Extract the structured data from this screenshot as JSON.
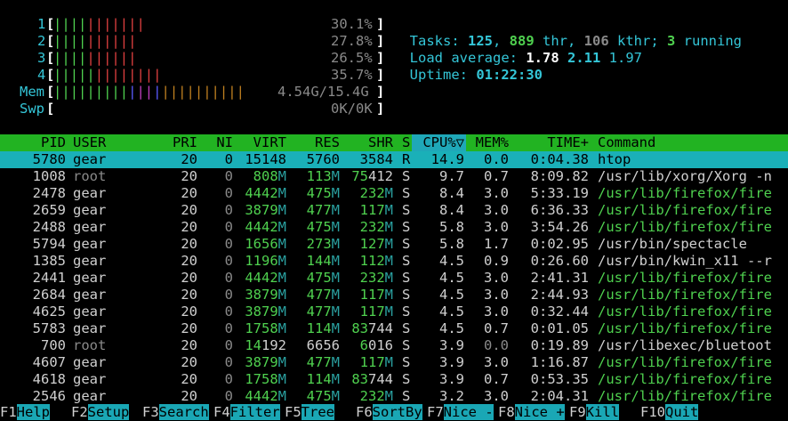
{
  "meters": {
    "cpus": [
      {
        "label": "1",
        "percent_text": "30.1%",
        "level": 30.1
      },
      {
        "label": "2",
        "percent_text": "27.8%",
        "level": 27.8
      },
      {
        "label": "3",
        "percent_text": "26.5%",
        "level": 26.5
      },
      {
        "label": "4",
        "percent_text": "35.7%",
        "level": 35.7
      }
    ],
    "mem": {
      "label": "Mem",
      "value": "4.54G/15.4G"
    },
    "swp": {
      "label": "Swp",
      "value": "0K/0K"
    }
  },
  "summary": {
    "tasks_label": "Tasks: ",
    "tasks": "125",
    "sep1": ", ",
    "threads": "889",
    "thr_label": " thr, ",
    "kthreads": "106",
    "kthr_label": " kthr; ",
    "running": "3",
    "running_label": " running",
    "load_label": "Load average: ",
    "load1": "1.78",
    "load5": "2.11",
    "load15": "1.97",
    "uptime_label": "Uptime: ",
    "uptime": "01:22:30"
  },
  "columns": {
    "pid": "PID",
    "user": "USER",
    "pri": "PRI",
    "ni": "NI",
    "virt": "VIRT",
    "res": "RES",
    "shr": "SHR",
    "s": "S",
    "cpu": "CPU%▽",
    "mem": "MEM%",
    "time": "TIME+",
    "command": "Command"
  },
  "processes": [
    {
      "pid": "5780",
      "user": "gear",
      "pri": "20",
      "ni": "0",
      "virt": "15148",
      "res": "5760",
      "shr": "3584",
      "s": "R",
      "cpu": "14.9",
      "mem": "0.0",
      "time": "0:04.38",
      "command": "htop"
    },
    {
      "pid": "1008",
      "user": "root",
      "pri": "20",
      "ni": "0",
      "virt": "808M",
      "res": "113M",
      "shr": "75412",
      "s": "S",
      "cpu": "9.7",
      "mem": "0.7",
      "time": "8:09.82",
      "command": "/usr/lib/xorg/Xorg -n"
    },
    {
      "pid": "2478",
      "user": "gear",
      "pri": "20",
      "ni": "0",
      "virt": "4442M",
      "res": "475M",
      "shr": "232M",
      "s": "S",
      "cpu": "8.4",
      "mem": "3.0",
      "time": "5:33.19",
      "command": "/usr/lib/firefox/fire"
    },
    {
      "pid": "2659",
      "user": "gear",
      "pri": "20",
      "ni": "0",
      "virt": "3879M",
      "res": "477M",
      "shr": "117M",
      "s": "S",
      "cpu": "8.4",
      "mem": "3.0",
      "time": "6:36.33",
      "command": "/usr/lib/firefox/fire"
    },
    {
      "pid": "2488",
      "user": "gear",
      "pri": "20",
      "ni": "0",
      "virt": "4442M",
      "res": "475M",
      "shr": "232M",
      "s": "S",
      "cpu": "5.8",
      "mem": "3.0",
      "time": "3:54.26",
      "command": "/usr/lib/firefox/fire"
    },
    {
      "pid": "5794",
      "user": "gear",
      "pri": "20",
      "ni": "0",
      "virt": "1656M",
      "res": "273M",
      "shr": "127M",
      "s": "S",
      "cpu": "5.8",
      "mem": "1.7",
      "time": "0:02.95",
      "command": "/usr/bin/spectacle"
    },
    {
      "pid": "1385",
      "user": "gear",
      "pri": "20",
      "ni": "0",
      "virt": "1196M",
      "res": "144M",
      "shr": "112M",
      "s": "S",
      "cpu": "4.5",
      "mem": "0.9",
      "time": "0:26.60",
      "command": "/usr/bin/kwin_x11 --r"
    },
    {
      "pid": "2441",
      "user": "gear",
      "pri": "20",
      "ni": "0",
      "virt": "4442M",
      "res": "475M",
      "shr": "232M",
      "s": "S",
      "cpu": "4.5",
      "mem": "3.0",
      "time": "2:41.31",
      "command": "/usr/lib/firefox/fire"
    },
    {
      "pid": "2684",
      "user": "gear",
      "pri": "20",
      "ni": "0",
      "virt": "3879M",
      "res": "477M",
      "shr": "117M",
      "s": "S",
      "cpu": "4.5",
      "mem": "3.0",
      "time": "2:44.93",
      "command": "/usr/lib/firefox/fire"
    },
    {
      "pid": "4625",
      "user": "gear",
      "pri": "20",
      "ni": "0",
      "virt": "3879M",
      "res": "477M",
      "shr": "117M",
      "s": "S",
      "cpu": "4.5",
      "mem": "3.0",
      "time": "0:32.44",
      "command": "/usr/lib/firefox/fire"
    },
    {
      "pid": "5783",
      "user": "gear",
      "pri": "20",
      "ni": "0",
      "virt": "1758M",
      "res": "114M",
      "shr": "83744",
      "s": "S",
      "cpu": "4.5",
      "mem": "0.7",
      "time": "0:01.05",
      "command": "/usr/lib/firefox/fire"
    },
    {
      "pid": "700",
      "user": "root",
      "pri": "20",
      "ni": "0",
      "virt": "14192",
      "res": "6656",
      "shr": "6016",
      "s": "S",
      "cpu": "3.9",
      "mem": "0.0",
      "time": "0:19.89",
      "command": "/usr/libexec/bluetoot"
    },
    {
      "pid": "4607",
      "user": "gear",
      "pri": "20",
      "ni": "0",
      "virt": "3879M",
      "res": "477M",
      "shr": "117M",
      "s": "S",
      "cpu": "3.9",
      "mem": "3.0",
      "time": "1:16.87",
      "command": "/usr/lib/firefox/fire"
    },
    {
      "pid": "4618",
      "user": "gear",
      "pri": "20",
      "ni": "0",
      "virt": "1758M",
      "res": "114M",
      "shr": "83744",
      "s": "S",
      "cpu": "3.9",
      "mem": "0.7",
      "time": "0:53.35",
      "command": "/usr/lib/firefox/fire"
    },
    {
      "pid": "2546",
      "user": "gear",
      "pri": "20",
      "ni": "0",
      "virt": "4442M",
      "res": "475M",
      "shr": "232M",
      "s": "S",
      "cpu": "3.2",
      "mem": "3.0",
      "time": "2:04.31",
      "command": "/usr/lib/firefox/fire"
    }
  ],
  "footer": [
    {
      "key": "F1",
      "label": "Help"
    },
    {
      "key": "F2",
      "label": "Setup"
    },
    {
      "key": "F3",
      "label": "Search"
    },
    {
      "key": "F4",
      "label": "Filter"
    },
    {
      "key": "F5",
      "label": "Tree"
    },
    {
      "key": "F6",
      "label": "SortBy"
    },
    {
      "key": "F7",
      "label": "Nice -"
    },
    {
      "key": "F8",
      "label": "Nice +"
    },
    {
      "key": "F9",
      "label": "Kill"
    },
    {
      "key": "F10",
      "label": "Quit"
    }
  ],
  "colors": {
    "header_bg": "#22b322",
    "selected_bg": "#1ab0b8",
    "cyan": "#34c6d8",
    "green": "#4fd14f"
  }
}
